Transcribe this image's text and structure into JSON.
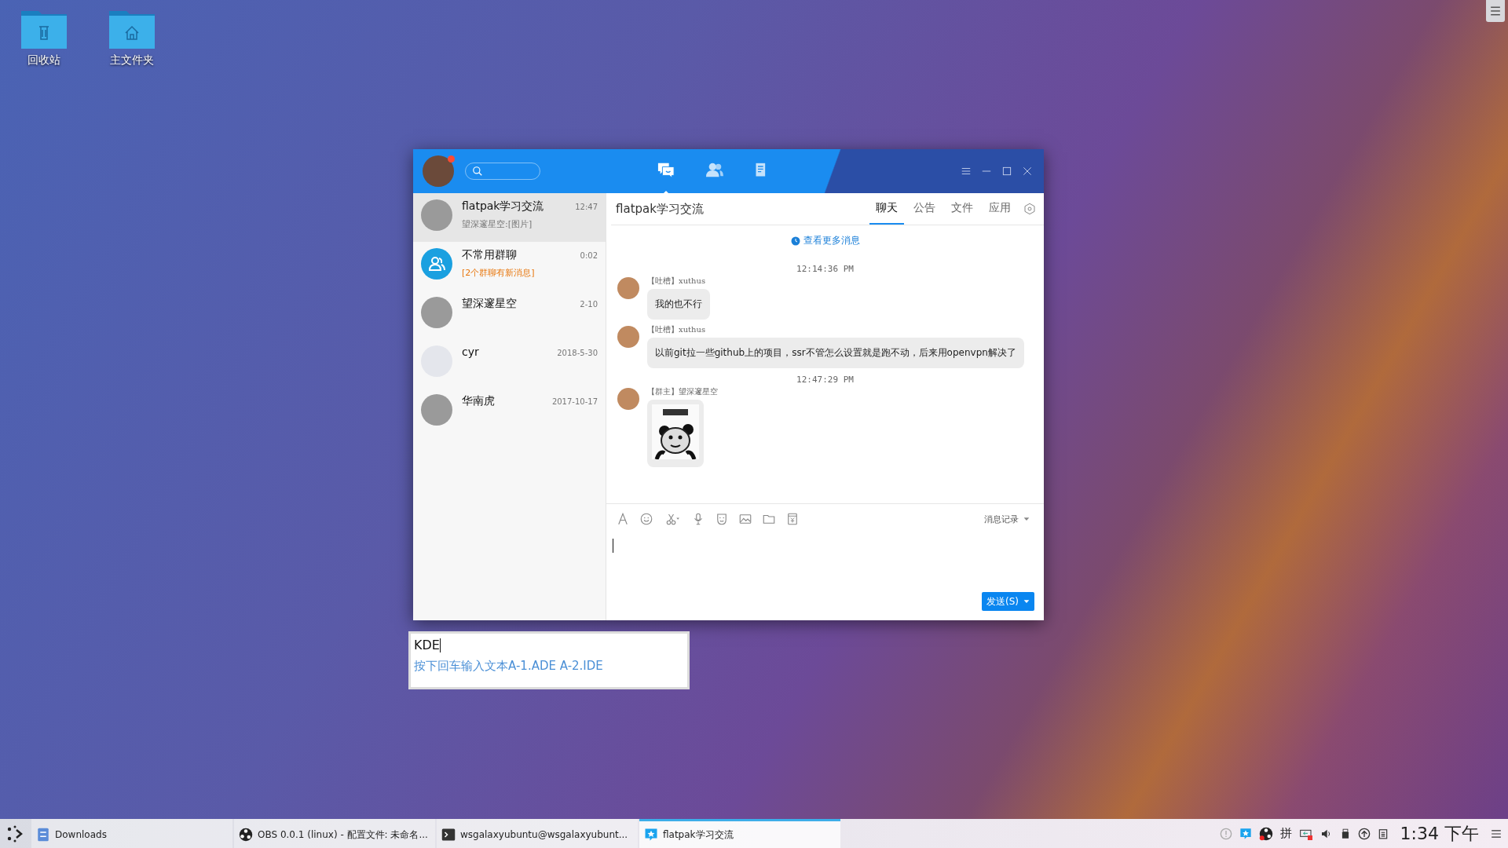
{
  "desktop": {
    "icons": [
      {
        "kind": "trash",
        "label": "回收站"
      },
      {
        "kind": "home",
        "label": "主文件夹"
      }
    ]
  },
  "window": {
    "header": {
      "has_notification": true,
      "nav": [
        {
          "kind": "chat",
          "selected": true
        },
        {
          "kind": "contacts",
          "selected": false
        },
        {
          "kind": "apps",
          "selected": false
        }
      ]
    },
    "conversations": [
      {
        "kind": "photo",
        "name": "flatpak学习交流",
        "time": "12:47",
        "preview": "望深邃星空:[图片]",
        "highlight": false,
        "selected": true
      },
      {
        "kind": "group",
        "name": "不常用群聊",
        "time": "0:02",
        "preview": "[2个群聊有新消息]",
        "highlight": true,
        "selected": false
      },
      {
        "kind": "photo",
        "name": "望深邃星空",
        "time": "2-10",
        "selected": false
      },
      {
        "kind": "people",
        "name": "cyr",
        "time": "2018-5-30",
        "selected": false
      },
      {
        "kind": "photo",
        "name": "华南虎",
        "time": "2017-10-17",
        "selected": false
      }
    ],
    "chat": {
      "title": "flatpak学习交流",
      "tabs": [
        {
          "label": "聊天",
          "selected": true
        },
        {
          "label": "公告",
          "selected": false
        },
        {
          "label": "文件",
          "selected": false
        },
        {
          "label": "应用",
          "selected": false
        }
      ],
      "more_link": "查看更多消息",
      "messages": [
        {
          "kind": "time",
          "text": "12:14:36 PM"
        },
        {
          "kind": "text",
          "sender": "【吐槽】xuthus",
          "text": "我的也不行"
        },
        {
          "kind": "text",
          "sender": "【吐槽】xuthus",
          "text": "以前git拉一些github上的项目，ssr不管怎么设置就是跑不动，后来用openvpn解决了"
        },
        {
          "kind": "time",
          "text": "12:47:29 PM"
        },
        {
          "kind": "image",
          "sender": "【群主】望深邃星空"
        }
      ],
      "history_label": "消息记录",
      "send_label": "发送(S)"
    }
  },
  "ime": {
    "input": "KDE",
    "hint": "按下回车输入文本A-1.ADE A-2.IDE"
  },
  "taskbar": {
    "tasks": [
      {
        "kind": "files",
        "label": "Downloads",
        "selected": false
      },
      {
        "kind": "obs",
        "label": "OBS 0.0.1 (linux) - 配置文件: 未命名...",
        "selected": false
      },
      {
        "kind": "terminal",
        "label": "wsgalaxyubuntu@wsgalaxyubunt...",
        "selected": false
      },
      {
        "kind": "chat",
        "label": "flatpak学习交流",
        "selected": true
      }
    ],
    "input_method": "拼",
    "clock": "1:34 下午"
  }
}
